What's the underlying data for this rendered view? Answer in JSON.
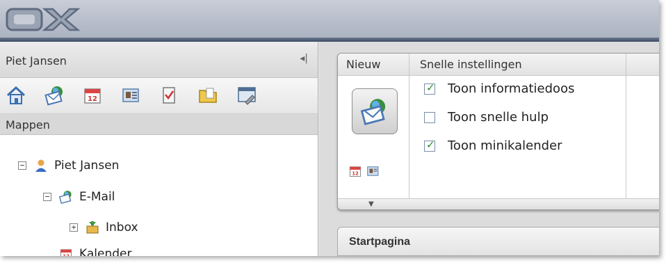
{
  "app": {
    "logo_text": "OX"
  },
  "left_panel": {
    "user_name": "Piet Jansen",
    "collapse_glyph": "◂|",
    "tools": [
      {
        "name": "home-icon"
      },
      {
        "name": "email-icon"
      },
      {
        "name": "calendar-icon"
      },
      {
        "name": "contacts-icon"
      },
      {
        "name": "tasks-icon"
      },
      {
        "name": "folder-icon"
      },
      {
        "name": "settings-icon"
      }
    ],
    "section_label": "Mappen",
    "tree": [
      {
        "label": "Piet Jansen",
        "expander": "−",
        "icon": "user-icon"
      },
      {
        "label": "E-Mail",
        "expander": "−",
        "icon": "email-icon"
      },
      {
        "label": "Inbox",
        "expander": "+",
        "icon": "inbox-icon"
      },
      {
        "label": "Kalender",
        "icon": "calendar-icon"
      }
    ]
  },
  "ribbon": {
    "tab_new": "Nieuw",
    "tab_quick_settings": "Snelle instellingen",
    "options": [
      {
        "label": "Toon informatiedoos",
        "checked": true
      },
      {
        "label": "Toon snelle hulp",
        "checked": false
      },
      {
        "label": "Toon minikalender",
        "checked": true
      }
    ]
  },
  "startpage": {
    "title": "Startpagina"
  },
  "colors": {
    "header_dark": "#3c4a63",
    "check_green": "#2a8a2a"
  }
}
